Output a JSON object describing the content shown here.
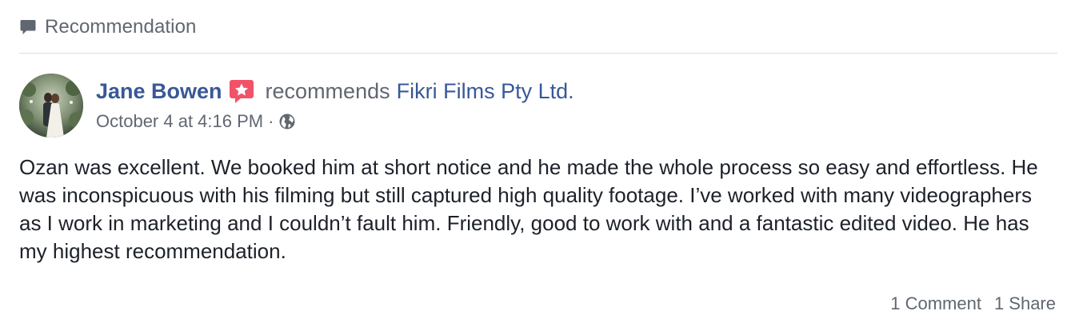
{
  "section": {
    "icon": "speech-bubble-icon",
    "label": "Recommendation"
  },
  "post": {
    "author": "Jane Bowen",
    "badge_icon": "recommendation-star-badge-icon",
    "verb": "recommends",
    "page_name": "Fikri Films Pty Ltd.",
    "timestamp": "October 4 at 4:16 PM",
    "separator": "·",
    "privacy_icon": "globe-icon",
    "body": "Ozan was excellent. We booked him at short notice and he made the whole process so easy and effortless. He was inconspicuous with his filming but still captured high quality footage. I’ve worked with many videographers as I work in marketing and I couldn’t fault him. Friendly, good to work with and a fantastic edited video. He has my highest recommendation."
  },
  "footer": {
    "comments": "1 Comment",
    "shares": "1 Share"
  },
  "colors": {
    "link": "#385898",
    "secondary_text": "#606770",
    "primary_text": "#1d2129",
    "badge": "#f25268",
    "divider": "#dadde1"
  }
}
